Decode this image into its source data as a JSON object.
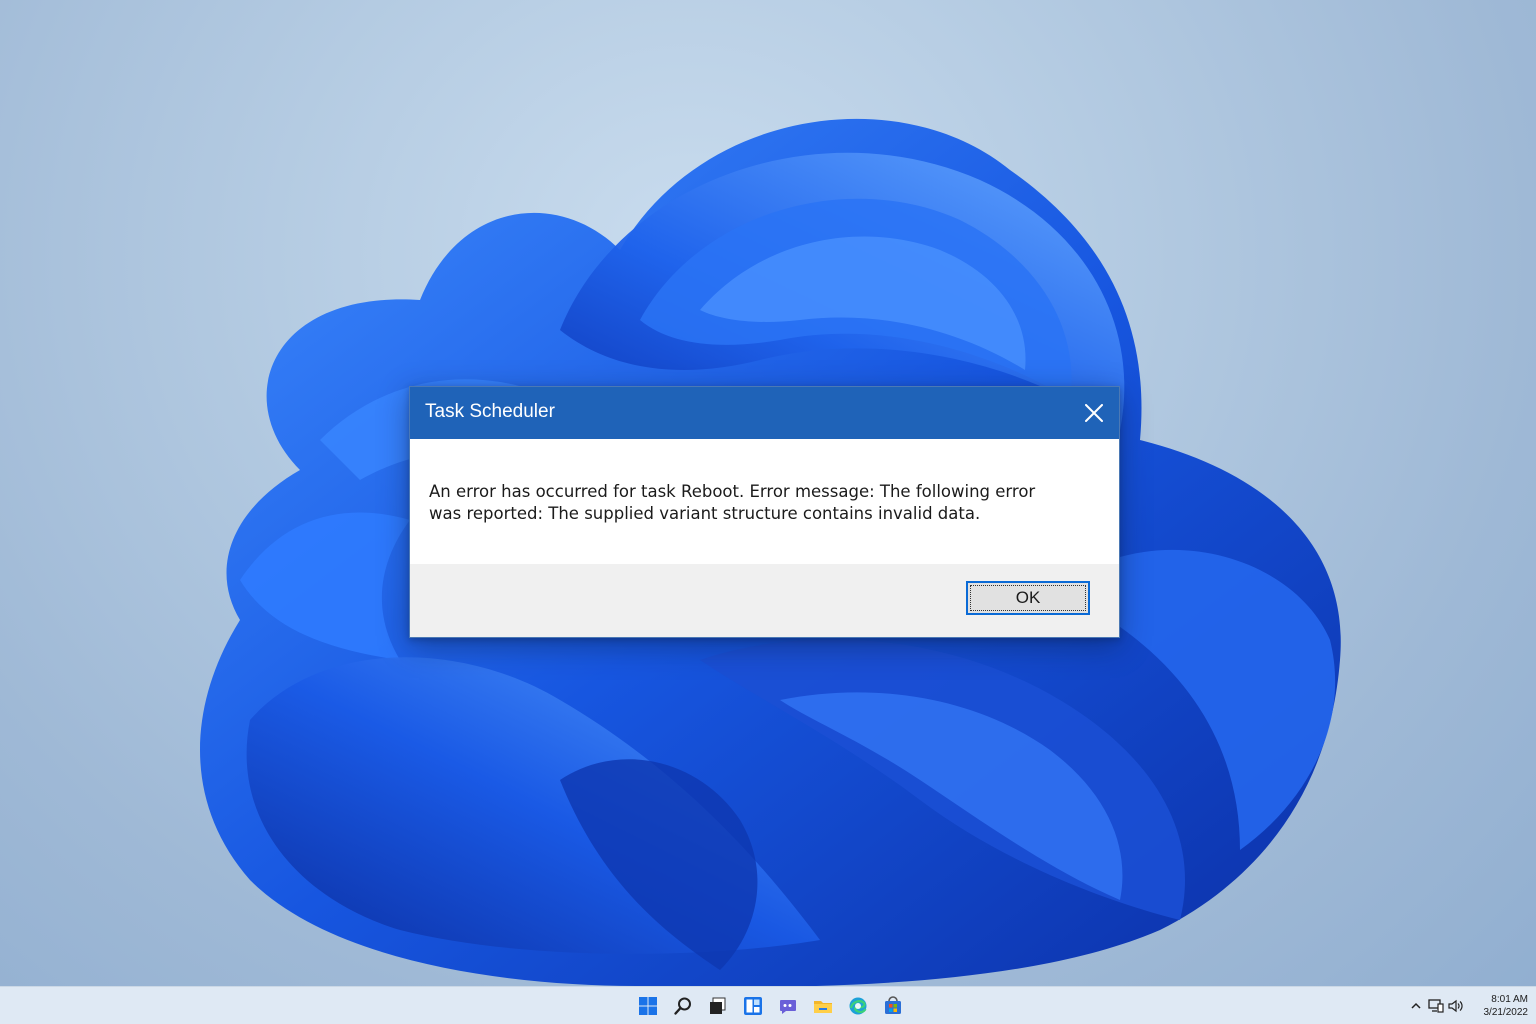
{
  "dialog": {
    "title": "Task Scheduler",
    "message": "An error has occurred for task Reboot. Error message: The following error was reported: The supplied variant structure contains invalid data.",
    "ok_label": "OK"
  },
  "taskbar": {
    "icons": [
      "start-icon",
      "search-icon",
      "task-view-icon",
      "widgets-icon",
      "chat-icon",
      "file-explorer-icon",
      "edge-icon",
      "store-icon"
    ],
    "tray_icons": [
      "chevron-up-icon",
      "network-icon",
      "volume-icon"
    ],
    "time": "8:01 AM",
    "date": "3/21/2022"
  },
  "colors": {
    "titlebar": "#1f63b8",
    "accent": "#0a6ad6",
    "wallpaper_bloom": "#1e5fe0"
  }
}
